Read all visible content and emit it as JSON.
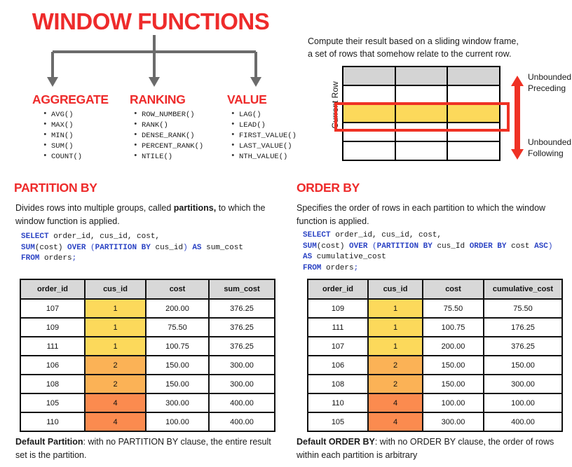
{
  "title": "WINDOW FUNCTIONS",
  "colors": {
    "accent_red": "#ee2b2b",
    "box_red": "#ef3124",
    "connector_gray": "#6b6b6b",
    "header_gray": "#d8d8d8",
    "group_1": "#fcd95b",
    "group_2": "#fbb256",
    "group_4": "#fb8b4f",
    "sql_keyword_blue": "#2b43c4"
  },
  "categories": [
    {
      "name": "AGGREGATE",
      "functions": [
        "AVG()",
        "MAX()",
        "MIN()",
        "SUM()",
        "COUNT()"
      ]
    },
    {
      "name": "RANKING",
      "functions": [
        "ROW_NUMBER()",
        "RANK()",
        "DENSE_RANK()",
        "PERCENT_RANK()",
        "NTILE()"
      ]
    },
    {
      "name": "VALUE",
      "functions": [
        "LAG()",
        "LEAD()",
        "FIRST_VALUE()",
        "LAST_VALUE()",
        "NTH_VALUE()"
      ]
    }
  ],
  "frame": {
    "description_line1": "Compute their result based on a sliding window frame,",
    "description_line2": "a set of rows that somehow relate to the current row.",
    "current_row_label": "Current Row",
    "unbounded_preceding": "Unbounded Preceding",
    "unbounded_following": "Unbounded Following",
    "grid": {
      "columns": 3,
      "rows": 5,
      "header_row_index": 0,
      "current_row_index": 2
    }
  },
  "partition_by": {
    "heading": "PARTITION BY",
    "description_pre": "Divides rows into multiple groups, called ",
    "description_bold": "partitions,",
    "description_post": " to which the window function is applied.",
    "sql": {
      "line1": "SELECT order_id, cus_id, cost,",
      "line2": "SUM(cost) OVER (PARTITION BY cus_id) AS sum_cost",
      "line3": "FROM orders;"
    },
    "table": {
      "headers": [
        "order_id",
        "cus_id",
        "cost",
        "sum_cost"
      ],
      "rows": [
        {
          "order_id": "107",
          "cus_id": "1",
          "cost": "200.00",
          "result": "376.25",
          "group": "1"
        },
        {
          "order_id": "109",
          "cus_id": "1",
          "cost": "75.50",
          "result": "376.25",
          "group": "1"
        },
        {
          "order_id": "111",
          "cus_id": "1",
          "cost": "100.75",
          "result": "376.25",
          "group": "1"
        },
        {
          "order_id": "106",
          "cus_id": "2",
          "cost": "150.00",
          "result": "300.00",
          "group": "2"
        },
        {
          "order_id": "108",
          "cus_id": "2",
          "cost": "150.00",
          "result": "300.00",
          "group": "2"
        },
        {
          "order_id": "105",
          "cus_id": "4",
          "cost": "300.00",
          "result": "400.00",
          "group": "4"
        },
        {
          "order_id": "110",
          "cus_id": "4",
          "cost": "100.00",
          "result": "400.00",
          "group": "4"
        }
      ]
    },
    "footer_bold": "Default Partition",
    "footer_rest": ": with no PARTITION BY clause, the entire result set is the partition."
  },
  "order_by": {
    "heading": "ORDER BY",
    "description": "Specifies the order of rows in each partition to which the window function is applied.",
    "sql": {
      "line1": "SELECT order_id, cus_id, cost,",
      "line2": "SUM(cost) OVER (PARTITION BY cus_Id ORDER BY cost ASC)",
      "line3": "AS cumulative_cost",
      "line4": "FROM orders;"
    },
    "table": {
      "headers": [
        "order_id",
        "cus_id",
        "cost",
        "cumulative_cost"
      ],
      "rows": [
        {
          "order_id": "109",
          "cus_id": "1",
          "cost": "75.50",
          "result": "75.50",
          "group": "1"
        },
        {
          "order_id": "111",
          "cus_id": "1",
          "cost": "100.75",
          "result": "176.25",
          "group": "1"
        },
        {
          "order_id": "107",
          "cus_id": "1",
          "cost": "200.00",
          "result": "376.25",
          "group": "1"
        },
        {
          "order_id": "106",
          "cus_id": "2",
          "cost": "150.00",
          "result": "150.00",
          "group": "2"
        },
        {
          "order_id": "108",
          "cus_id": "2",
          "cost": "150.00",
          "result": "300.00",
          "group": "2"
        },
        {
          "order_id": "110",
          "cus_id": "4",
          "cost": "100.00",
          "result": "100.00",
          "group": "4"
        },
        {
          "order_id": "105",
          "cus_id": "4",
          "cost": "300.00",
          "result": "400.00",
          "group": "4"
        }
      ]
    },
    "footer_bold": "Default ORDER BY",
    "footer_rest": ": with no ORDER BY clause, the order of rows within each partition is arbitrary"
  }
}
